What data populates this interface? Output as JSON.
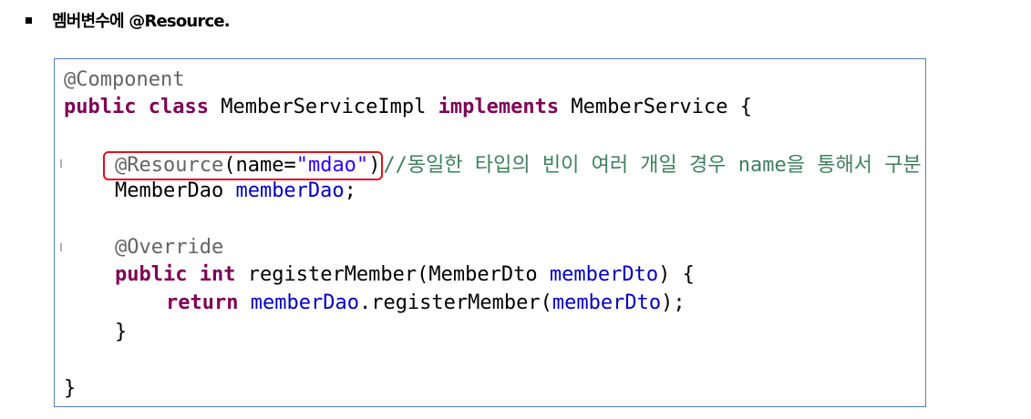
{
  "heading": {
    "bullet_icon": "square-bullet-icon",
    "text": "멤버변수에 @Resource."
  },
  "code": {
    "line1": {
      "annotation": "@Component"
    },
    "line2": {
      "kw_public": "public",
      "kw_class": "class",
      "class_name": " MemberServiceImpl ",
      "kw_implements": "implements",
      "interface_name": " MemberService {"
    },
    "line4": {
      "annotation": "@Resource",
      "open": "(name=",
      "string": "\"mdao\"",
      "close": ")",
      "comment": "//동일한 타입의 빈이 여러 개일 경우 name을 통해서 구분."
    },
    "line5": {
      "type": "MemberDao ",
      "field": "memberDao",
      "semi": ";"
    },
    "line7": {
      "annotation": "@Override"
    },
    "line8": {
      "kw_public": "public",
      "kw_int": "int",
      "signature": " registerMember(MemberDto ",
      "param": "memberDto",
      "end": ") {"
    },
    "line9": {
      "kw_return": "return",
      "field": "memberDao",
      "call": ".registerMember(",
      "param": "memberDto",
      "end": ");"
    },
    "line10": {
      "brace": "}"
    },
    "line12": {
      "brace": "}"
    }
  },
  "colors": {
    "keyword": "#7f0055",
    "annotation": "#646464",
    "field": "#0000c0",
    "string": "#2a00ff",
    "comment": "#3f7f5f",
    "highlight_border": "#e0101e",
    "box_border": "#4f81bd"
  }
}
